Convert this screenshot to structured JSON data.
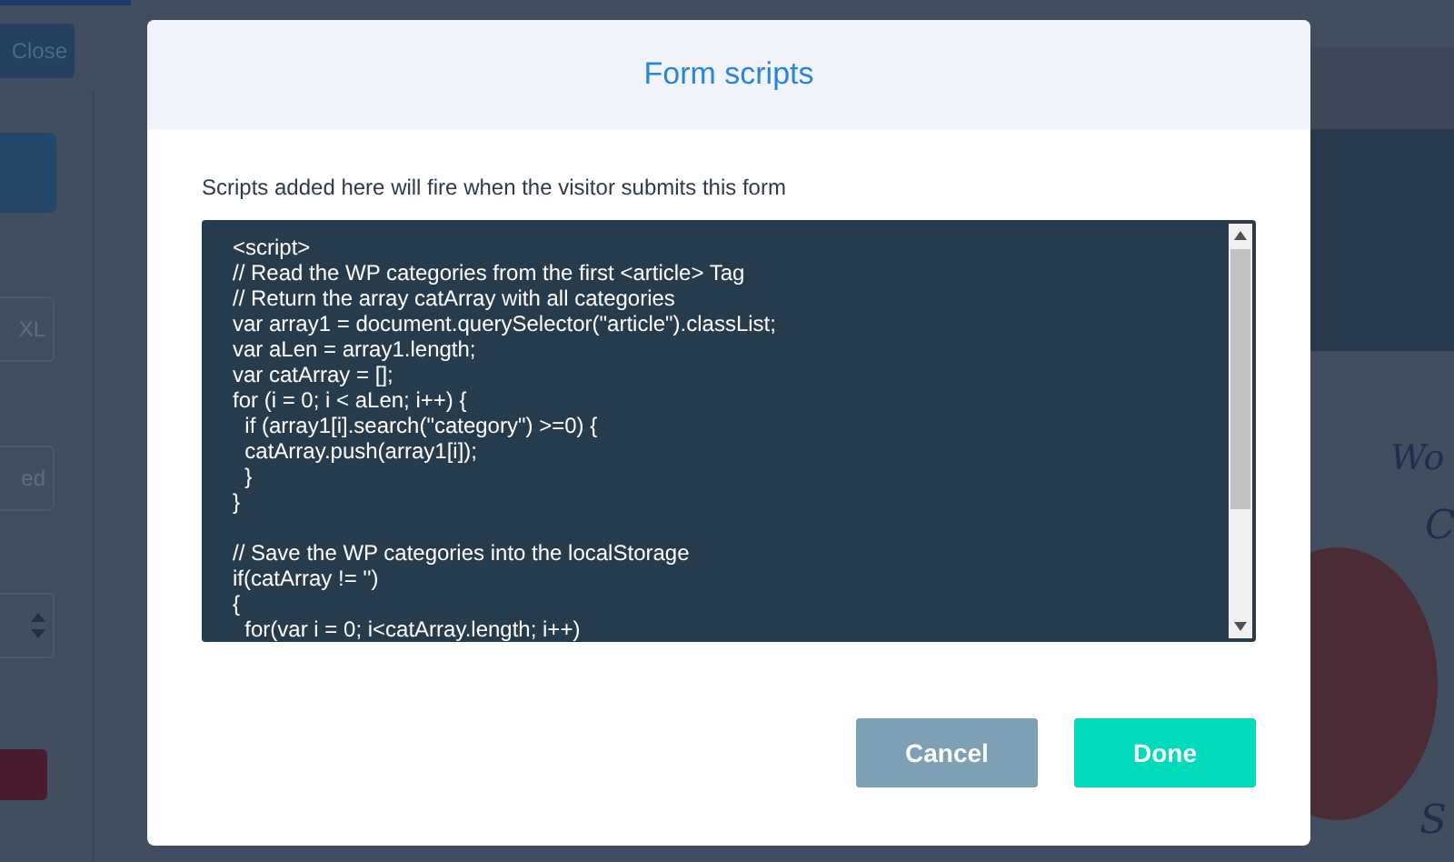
{
  "background": {
    "close_button": "Close",
    "fields": [
      "XL",
      "ed"
    ],
    "preview_texts": [
      "Wo",
      "C",
      "S"
    ]
  },
  "dialog": {
    "title": "Form scripts",
    "description": "Scripts added here will fire when the visitor submits this form",
    "code": "<script>\n// Read the WP categories from the first <article> Tag\n// Return the array catArray with all categories\nvar array1 = document.querySelector(\"article\").classList;\nvar aLen = array1.length;\nvar catArray = [];\nfor (i = 0; i < aLen; i++) {\n  if (array1[i].search(\"category\") >=0) {\n  catArray.push(array1[i]);\n  }\n}\n\n// Save the WP categories into the localStorage\nif(catArray != '')\n{\n  for(var i = 0; i<catArray.length; i++)",
    "buttons": [
      {
        "label": "Cancel",
        "kind": "secondary"
      },
      {
        "label": "Done",
        "kind": "primary"
      }
    ]
  }
}
